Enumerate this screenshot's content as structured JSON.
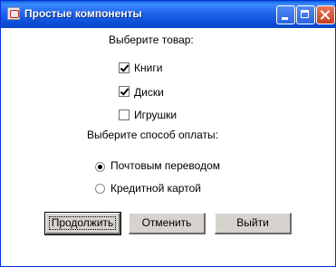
{
  "window": {
    "title": "Простые компоненты"
  },
  "product": {
    "heading": "Выберите товар:",
    "options": [
      {
        "label": "Книги",
        "checked": true
      },
      {
        "label": "Диски",
        "checked": true
      },
      {
        "label": "Игрушки",
        "checked": false
      }
    ]
  },
  "payment": {
    "heading": "Выберите способ оплаты:",
    "options": [
      {
        "label": "Почтовым переводом",
        "selected": true
      },
      {
        "label": "Кредитной картой",
        "selected": false
      }
    ]
  },
  "buttons": {
    "continue_label": "Продолжить",
    "cancel_label": "Отменить",
    "exit_label": "Выйти"
  },
  "icons": {
    "app": "java-cup-icon",
    "minimize": "minimize-icon",
    "maximize": "maximize-icon",
    "close": "close-icon"
  },
  "colors": {
    "titlebar": "#0a5ce0",
    "close_button": "#c8401e",
    "button_face": "#d6d3ce"
  }
}
